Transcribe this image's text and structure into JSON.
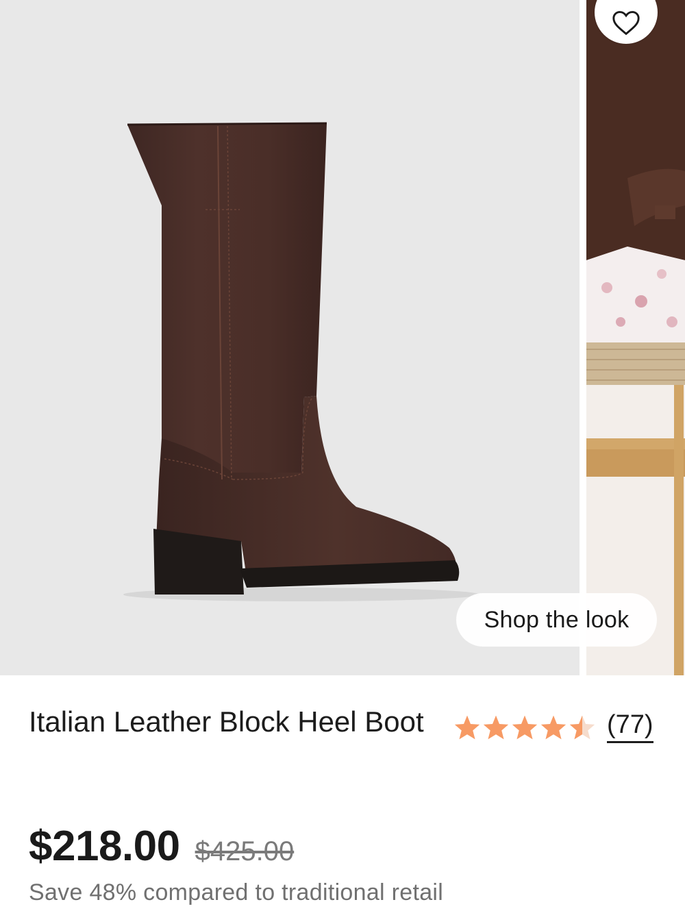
{
  "gallery": {
    "main_image": "product-boot-photo",
    "secondary_image": "model-lifestyle-photo",
    "shop_the_look_label": "Shop the look",
    "wishlist_icon": "heart-outline-icon"
  },
  "product": {
    "title": "Italian Leather Block Heel Boot",
    "rating": {
      "value": 4.5,
      "max": 5,
      "review_count_label": "(77)",
      "star_color": "#F79A64"
    },
    "price": "$218.00",
    "compare_price": "$425.00",
    "savings_text": "Save 48% compared to traditional retail"
  }
}
